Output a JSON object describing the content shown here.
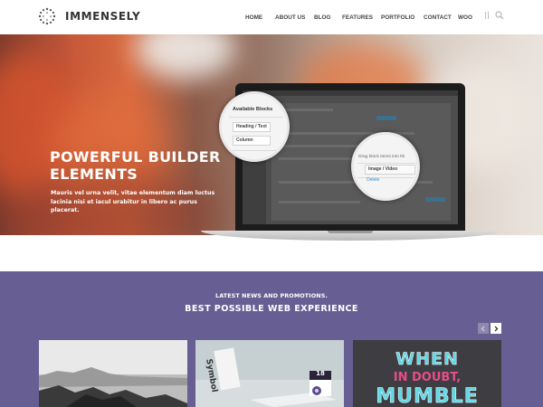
{
  "brand": {
    "name": "IMMENSELY"
  },
  "nav": {
    "items": [
      "HOME",
      "ABOUT US",
      "BLOG",
      "FEATURES",
      "PORTFOLIO",
      "CONTACT",
      "WOO"
    ],
    "icons": [
      "menu-lines-icon",
      "search-icon"
    ]
  },
  "hero": {
    "title": "POWERFUL BUILDER ELEMENTS",
    "text": "Mauris vel urna velit, vitae elementum diam luctus lacinia nisi et iacul urabitur in libero ac purus placerat."
  },
  "builder": {
    "available_blocks": "Available Blocks",
    "blocks": [
      "Heading / Text",
      "Column"
    ],
    "drag_hint": "Drag block items into thi",
    "dropped_block": "Image / Video",
    "delete": "Delete"
  },
  "news": {
    "kicker": "LATEST NEWS AND PROMOTIONS.",
    "title": "BEST POSSIBLE WEB EXPERIENCE",
    "arrows": [
      "chevron-left-icon",
      "chevron-right-icon"
    ]
  },
  "cards": {
    "notebook_label": "Symbol",
    "calendar_day": "18",
    "poster_lines": [
      "WHEN",
      "IN DOUBT,",
      "MUMBLE"
    ]
  },
  "colors": {
    "section_bg": "#675e93",
    "poster_cyan": "#5fd7e6"
  }
}
